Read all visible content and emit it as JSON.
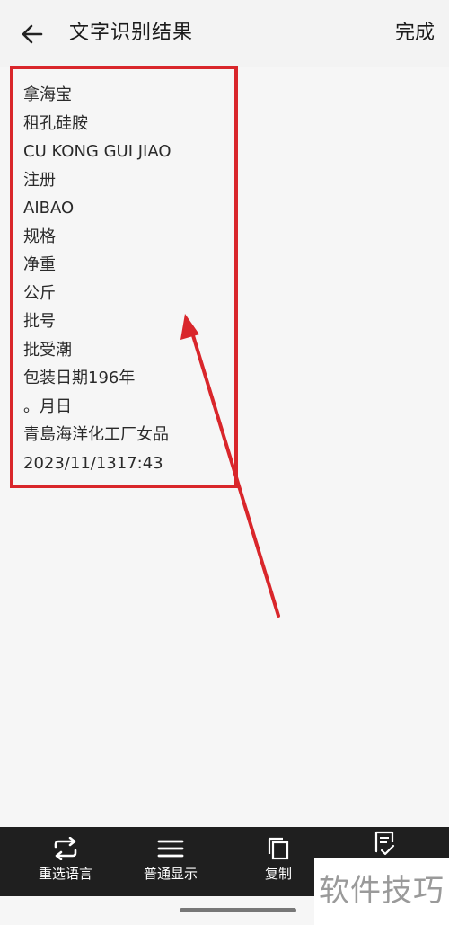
{
  "header": {
    "back_icon": "arrow-left-icon",
    "title": "文字识别结果",
    "done_label": "完成"
  },
  "ocr_lines": [
    "拿海宝",
    "租孔硅胺",
    "CU KONG GUI JIAO",
    "注册",
    "AIBAO",
    "规格",
    "净重",
    "公斤",
    "批号",
    "批受潮",
    "包装日期196年",
    "。月日",
    "青島海洋化工厂女品",
    "2023/11/1317:43"
  ],
  "toolbar": {
    "reselect_language": "重选语言",
    "normal_display": "普通显示",
    "copy": "复制"
  },
  "watermark": "软件技巧",
  "colors": {
    "annotation": "#d9262b",
    "toolbar_bg": "#1f1f1f"
  }
}
